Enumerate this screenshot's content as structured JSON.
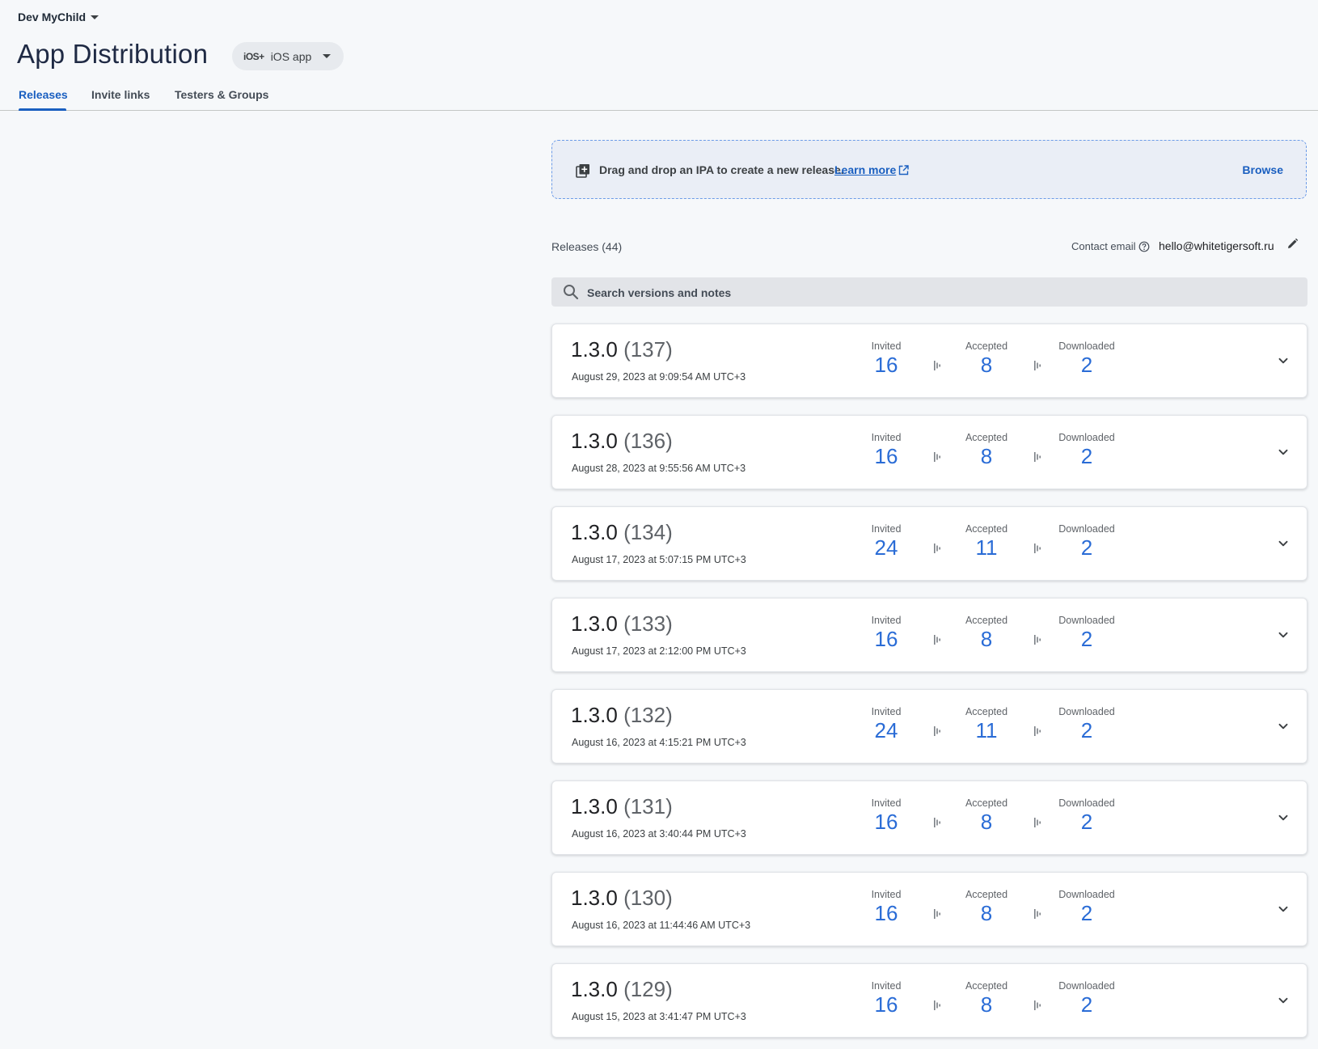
{
  "header": {
    "project_name": "Dev MyChild",
    "page_title": "App Distribution",
    "app_chip": {
      "platform_glyph": "iOS+",
      "label": "iOS app"
    }
  },
  "tabs": [
    {
      "label": "Releases",
      "active": true
    },
    {
      "label": "Invite links",
      "active": false
    },
    {
      "label": "Testers & Groups",
      "active": false
    }
  ],
  "dropzone": {
    "text": "Drag and drop an IPA to create a new release.",
    "learn_more": "Learn more",
    "browse": "Browse"
  },
  "releases_meta": {
    "count_label": "Releases (44)",
    "contact_label": "Contact email",
    "contact_email": "hello@whitetigersoft.ru"
  },
  "search": {
    "placeholder": "Search versions and notes"
  },
  "stat_labels": {
    "invited": "Invited",
    "accepted": "Accepted",
    "downloaded": "Downloaded"
  },
  "releases": [
    {
      "version": "1.3.0",
      "build": "(137)",
      "date": "August 29, 2023 at 9:09:54 AM UTC+3",
      "invited": "16",
      "accepted": "8",
      "downloaded": "2"
    },
    {
      "version": "1.3.0",
      "build": "(136)",
      "date": "August 28, 2023 at 9:55:56 AM UTC+3",
      "invited": "16",
      "accepted": "8",
      "downloaded": "2"
    },
    {
      "version": "1.3.0",
      "build": "(134)",
      "date": "August 17, 2023 at 5:07:15 PM UTC+3",
      "invited": "24",
      "accepted": "11",
      "downloaded": "2"
    },
    {
      "version": "1.3.0",
      "build": "(133)",
      "date": "August 17, 2023 at 2:12:00 PM UTC+3",
      "invited": "16",
      "accepted": "8",
      "downloaded": "2"
    },
    {
      "version": "1.3.0",
      "build": "(132)",
      "date": "August 16, 2023 at 4:15:21 PM UTC+3",
      "invited": "24",
      "accepted": "11",
      "downloaded": "2"
    },
    {
      "version": "1.3.0",
      "build": "(131)",
      "date": "August 16, 2023 at 3:40:44 PM UTC+3",
      "invited": "16",
      "accepted": "8",
      "downloaded": "2"
    },
    {
      "version": "1.3.0",
      "build": "(130)",
      "date": "August 16, 2023 at 11:44:46 AM UTC+3",
      "invited": "16",
      "accepted": "8",
      "downloaded": "2"
    },
    {
      "version": "1.3.0",
      "build": "(129)",
      "date": "August 15, 2023 at 3:41:47 PM UTC+3",
      "invited": "16",
      "accepted": "8",
      "downloaded": "2"
    }
  ],
  "colors": {
    "accent": "#1a5fc0",
    "stat_value": "#2a6cd6",
    "background": "#f6f8fa"
  }
}
